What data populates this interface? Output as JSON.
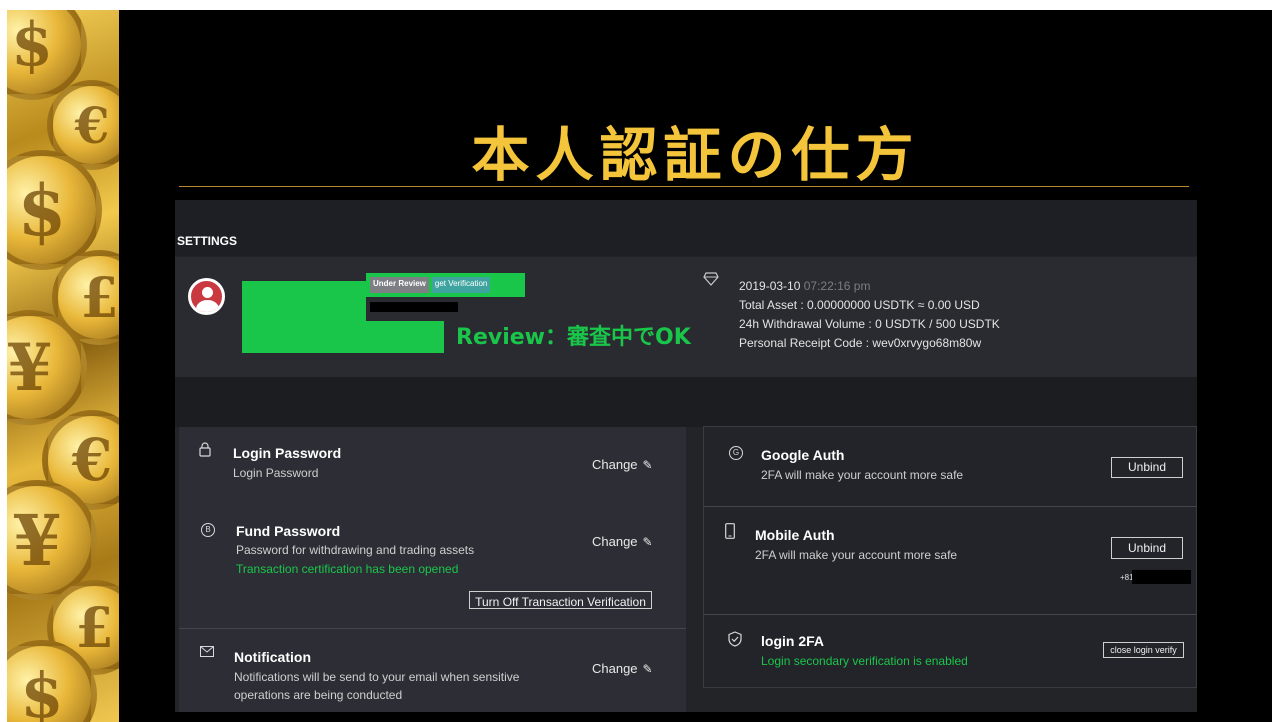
{
  "slide": {
    "title": "本人認証の仕方",
    "annotation": "Review：審査中でOK"
  },
  "settings": {
    "label": "SETTINGS"
  },
  "profile": {
    "badges": {
      "under_review": "Under Review",
      "get_verification": "get Verification"
    },
    "date": "2019-03-10",
    "time": "07:22:16 pm",
    "total_asset": "Total Asset : 0.00000000 USDTK ≈ 0.00 USD",
    "withdrawal_volume": "24h Withdrawal Volume : 0 USDTK / 500 USDTK",
    "receipt_code": "Personal Receipt Code : wev0xrvygo68m80w"
  },
  "security_left": {
    "login_password": {
      "title": "Login Password",
      "subtitle": "Login Password",
      "action": "Change"
    },
    "fund_password": {
      "title": "Fund Password",
      "subtitle": "Password for withdrawing and trading assets",
      "status": "Transaction certification has been opened",
      "action": "Change",
      "turn_off_button": "Turn Off Transaction Verification"
    },
    "notification": {
      "title": "Notification",
      "subtitle_line1": "Notifications will be send to your email when sensitive",
      "subtitle_line2": "operations are being conducted",
      "action": "Change"
    }
  },
  "security_right": {
    "google_auth": {
      "title": "Google Auth",
      "subtitle": "2FA will make your account more safe",
      "button": "Unbind"
    },
    "mobile_auth": {
      "title": "Mobile Auth",
      "subtitle": "2FA will make your account more safe",
      "button": "Unbind",
      "phone_prefix": "+81"
    },
    "login_2fa": {
      "title": "login 2FA",
      "status": "Login secondary verification is enabled",
      "button": "close login verify"
    }
  },
  "colors": {
    "title_gold": "#f4c53a",
    "accent_green": "#19c64a",
    "panel_bg": "#232428"
  }
}
